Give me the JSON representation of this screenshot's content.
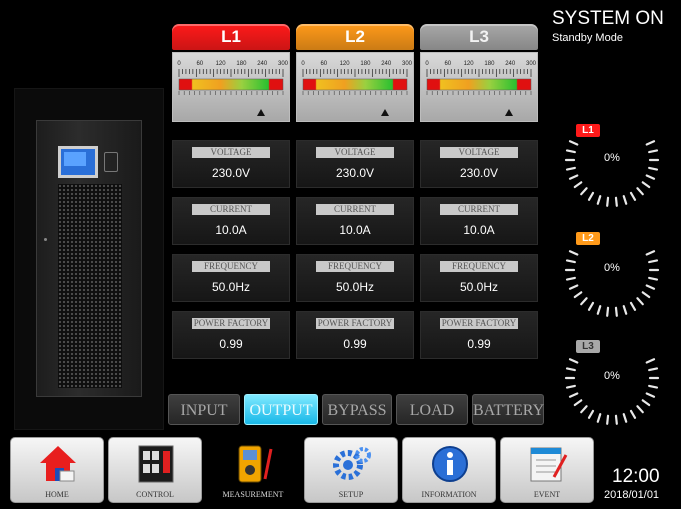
{
  "system": {
    "status": "SYSTEM ON",
    "mode": "Standby Mode"
  },
  "meter_scale": [
    "0",
    "60",
    "120",
    "180",
    "240",
    "300"
  ],
  "phases": [
    {
      "name": "L1",
      "color": "#ff1a1a",
      "voltage": "230.0V",
      "current": "10.0A",
      "frequency": "50.0Hz",
      "power_factor": "0.99",
      "load": "0%"
    },
    {
      "name": "L2",
      "color": "#ff9a1a",
      "voltage": "230.0V",
      "current": "10.0A",
      "frequency": "50.0Hz",
      "power_factor": "0.99",
      "load": "0%"
    },
    {
      "name": "L3",
      "color": "#a8a8a8",
      "voltage": "230.0V",
      "current": "10.0A",
      "frequency": "50.0Hz",
      "power_factor": "0.99",
      "load": "0%"
    }
  ],
  "labels": {
    "voltage": "VOLTAGE",
    "current": "CURRENT",
    "frequency": "FREQUENCY",
    "power_factor": "POWER FACTORY"
  },
  "tabs": [
    {
      "label": "INPUT",
      "active": false
    },
    {
      "label": "OUTPUT",
      "active": true
    },
    {
      "label": "BYPASS",
      "active": false
    },
    {
      "label": "LOAD",
      "active": false
    },
    {
      "label": "BATTERY",
      "active": false
    }
  ],
  "nav": [
    {
      "label": "HOME",
      "icon": "home-icon",
      "selected": false
    },
    {
      "label": "CONTROL",
      "icon": "control-panel-icon",
      "selected": false
    },
    {
      "label": "MEASUREMENT",
      "icon": "multimeter-icon",
      "selected": true
    },
    {
      "label": "SETUP",
      "icon": "gears-icon",
      "selected": false
    },
    {
      "label": "INFORMATION",
      "icon": "info-icon",
      "selected": false
    },
    {
      "label": "EVENT",
      "icon": "event-log-icon",
      "selected": false
    }
  ],
  "clock": {
    "time": "12:00",
    "date": "2018/01/01"
  }
}
